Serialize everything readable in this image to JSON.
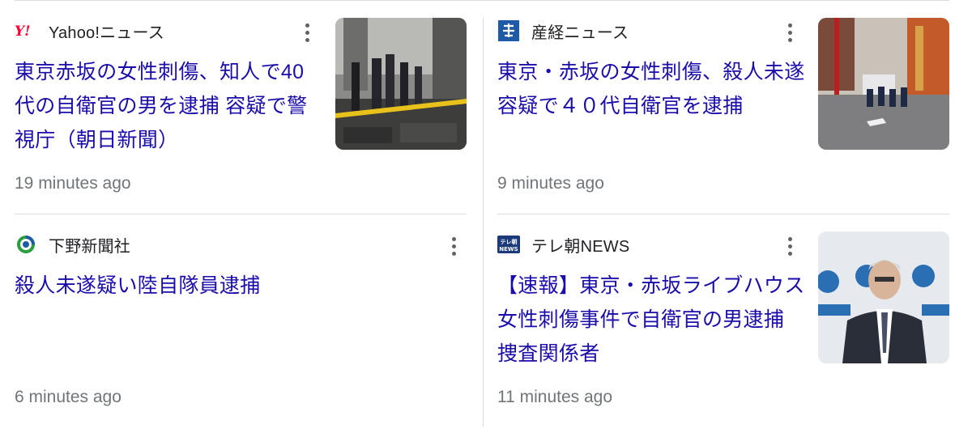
{
  "cards": [
    {
      "source": "Yahoo!ニュース",
      "logo_icon": "yahoo-logo-icon",
      "headline": "東京赤坂の女性刺傷、知人で40代の自衛官の男を逮捕 容疑で警視庁（朝日新聞）",
      "timestamp": "19 minutes ago",
      "thumbnail": "police-cordon-photo"
    },
    {
      "source": "産経ニュース",
      "logo_icon": "sankei-logo-icon",
      "headline": "東京・赤坂の女性刺傷、殺人未遂容疑で４０代自衛官を逮捕",
      "timestamp": "9 minutes ago",
      "thumbnail": "street-police-photo"
    },
    {
      "source": "下野新聞社",
      "logo_icon": "shimotsuke-logo-icon",
      "headline": "殺人未遂疑い陸自隊員逮捕",
      "timestamp": "6 minutes ago"
    },
    {
      "source": "テレ朝NEWS",
      "logo_icon": "tvasahi-news-logo-icon",
      "headline": "【速報】東京・赤坂ライブハウス女性刺傷事件で自衛官の男逮捕 捜査関係者",
      "timestamp": "11 minutes ago",
      "thumbnail": "press-conference-photo"
    }
  ],
  "colors": {
    "headline": "#1a0dab",
    "source": "#202124",
    "timestamp": "#70757a",
    "divider": "#dadce0",
    "yahoo_red": "#ff0033",
    "sankei_blue": "#1f5aa6",
    "shimotsuke_green": "#2a9d3f",
    "tvasahi_navy": "#1b3a7a"
  }
}
